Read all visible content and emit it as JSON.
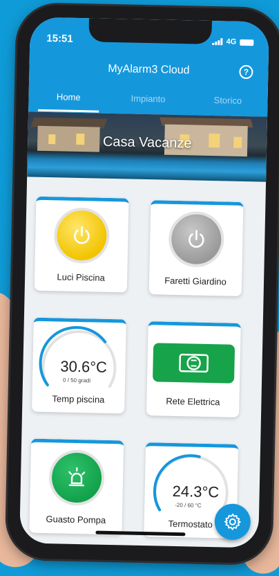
{
  "status_bar": {
    "time": "15:51",
    "network": "4G"
  },
  "app": {
    "title": "MyAlarm3 Cloud",
    "help_icon": "help-circle-icon"
  },
  "tabs": [
    {
      "label": "Home",
      "active": true
    },
    {
      "label": "Impianto",
      "active": false
    },
    {
      "label": "Storico",
      "active": false
    }
  ],
  "banner": {
    "title": "Casa Vacanze"
  },
  "tiles": {
    "luci_piscina": {
      "label": "Luci Piscina",
      "icon": "power-icon",
      "color": "#f2c400"
    },
    "faretti_giardino": {
      "label": "Faretti Giardino",
      "icon": "power-icon",
      "color": "#9a9a9a"
    },
    "temp_piscina": {
      "label": "Temp piscina",
      "value": "30.6°C",
      "range": "0 / 50 gradi"
    },
    "rete_elettrica": {
      "label": "Rete Elettrica",
      "icon": "power-plug-icon",
      "color": "#17a34a"
    },
    "guasto_pompa": {
      "label": "Guasto Pompa",
      "icon": "siren-icon",
      "color": "#12a24b"
    },
    "termostato": {
      "label": "Termostato",
      "value": "24.3°C",
      "range": "-20 / 60 °C"
    }
  },
  "fab": {
    "icon": "gear-icon"
  },
  "colors": {
    "accent": "#1597dc",
    "background": "#0f9bd8"
  }
}
